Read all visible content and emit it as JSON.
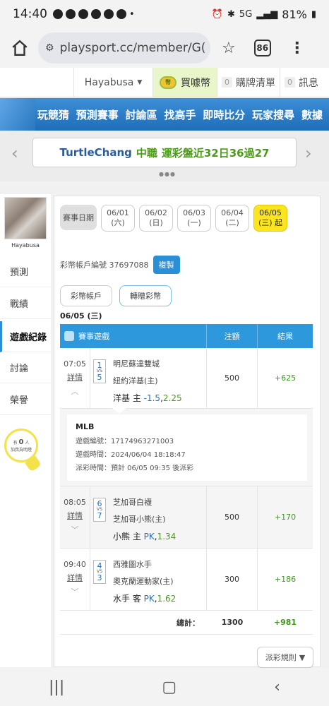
{
  "status": {
    "time": "14:40",
    "battery": "81%",
    "network": "5G"
  },
  "browser": {
    "url": "playsport.cc/member/G(",
    "tab_count": "86"
  },
  "topbar": {
    "username": "Hayabusa",
    "coin_label": "買噱幣",
    "cart_count": "0",
    "cart_label": "購牌清單",
    "msg_count": "0",
    "msg_label": "訊息"
  },
  "nav": [
    "玩競猜",
    "預測賽事",
    "討論區",
    "找高手",
    "即時比分",
    "玩家搜尋",
    "數據"
  ],
  "ticker": {
    "name": "TurtleChang",
    "league": "中職",
    "text": "運彩盤近32日36過27"
  },
  "sidebar": {
    "username": "Hayabusa",
    "items": [
      "預測",
      "戰績",
      "遊戲紀錄",
      "討論",
      "榮譽"
    ],
    "bulb_prefix": "有",
    "bulb_count": "0",
    "bulb_unit": "人",
    "bulb_text": "加我為明燈"
  },
  "dates": {
    "label": "賽事日期",
    "items": [
      {
        "date": "06/01",
        "day": "(六)"
      },
      {
        "date": "06/02",
        "day": "(日)"
      },
      {
        "date": "06/03",
        "day": "(一)"
      },
      {
        "date": "06/04",
        "day": "(二)"
      },
      {
        "date": "06/05",
        "day": "(三) 起"
      }
    ]
  },
  "account": {
    "label": "彩幣帳戶編號 37697088",
    "copy_label": "複製"
  },
  "tabs": [
    "彩幣帳戶",
    "轉贈彩幣"
  ],
  "current_date": "06/05 (三)",
  "table": {
    "headers": [
      "賽事遊戲",
      "注額",
      "結果"
    ],
    "rows": [
      {
        "time": "07:05",
        "detail": "詳情",
        "score_a": "1",
        "score_b": "5",
        "team_a": "明尼蘇達雙城",
        "team_b": "紐約洋基(主)",
        "pick": "洋基 主",
        "odds": "-1.5",
        "rate": "2.25",
        "amount": "500",
        "result": "+625"
      },
      {
        "time": "08:05",
        "detail": "詳情",
        "score_a": "6",
        "score_b": "7",
        "team_a": "芝加哥白襪",
        "team_b": "芝加哥小熊(主)",
        "pick": "小熊 主",
        "odds": "PK",
        "rate": "1.34",
        "amount": "500",
        "result": "+170"
      },
      {
        "time": "09:40",
        "detail": "詳情",
        "score_a": "4",
        "score_b": "3",
        "team_a": "西雅圖水手",
        "team_b": "奧克蘭運動家(主)",
        "pick": "水手 客",
        "odds": "PK",
        "rate": "1.62",
        "amount": "300",
        "result": "+186"
      }
    ],
    "vs": "VS",
    "detail_box": {
      "league": "MLB",
      "game_no": "遊戲編號：17174963271003",
      "game_time": "遊戲時間：2024/06/04 18:18:47",
      "payout_time": "派彩時間：預計 06/05 09:35 後派彩"
    },
    "total_label": "總計：",
    "total_amount": "1300",
    "total_result": "+981"
  },
  "rules_label": "派彩規則"
}
